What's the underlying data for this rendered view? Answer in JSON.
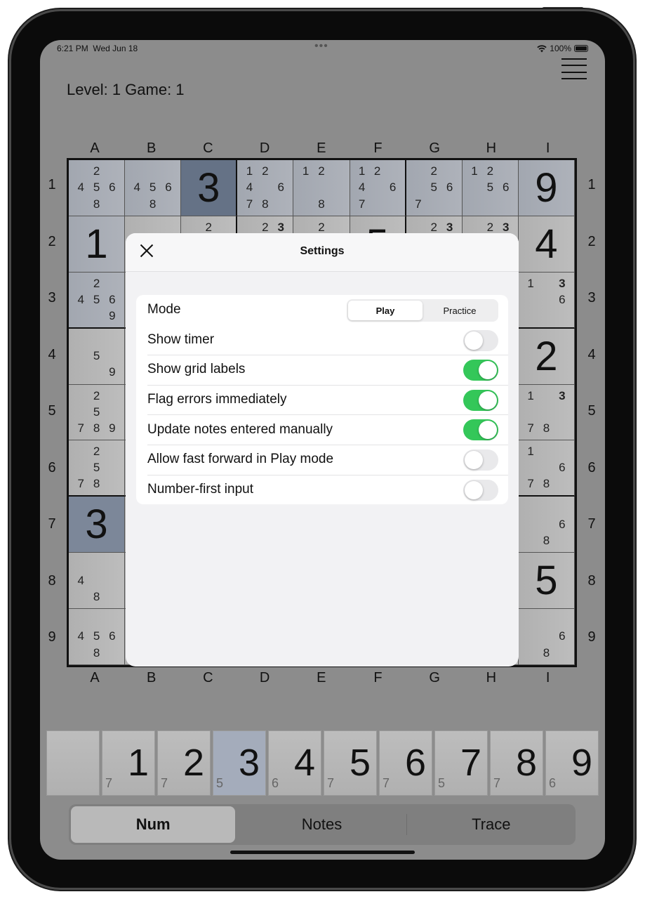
{
  "status": {
    "time": "6:21 PM",
    "date": "Wed Jun 18",
    "dots": "•••",
    "wifi": "◔",
    "battery": "100%"
  },
  "header": {
    "level_game": "Level: 1  Game: 1"
  },
  "columns": [
    "A",
    "B",
    "C",
    "D",
    "E",
    "F",
    "G",
    "H",
    "I"
  ],
  "rows": [
    "1",
    "2",
    "3",
    "4",
    "5",
    "6",
    "7",
    "8",
    "9"
  ],
  "board": [
    [
      {
        "n": "2 456 8",
        "s": "hl"
      },
      {
        "n": "456 8",
        "s": "hl"
      },
      {
        "v": "3",
        "s": "sel"
      },
      {
        "n": "12 4 6 78",
        "s": "hl"
      },
      {
        "n": "12  8",
        "s": "hl"
      },
      {
        "n": "12 4 6 7",
        "s": "hl"
      },
      {
        "n": "2 56 7",
        "s": "hl"
      },
      {
        "n": "12 56",
        "s": "hl"
      },
      {
        "v": "9",
        "s": "hl"
      }
    ],
    [
      {
        "v": "1",
        "s": "hl"
      },
      {
        "n": "",
        "s": ""
      },
      {
        "n": "2",
        "s": ""
      },
      {
        "n": "2B3",
        "s": ""
      },
      {
        "n": "2",
        "s": ""
      },
      {
        "v": "5",
        "s": ""
      },
      {
        "n": "2B3",
        "s": ""
      },
      {
        "n": "2B3",
        "s": ""
      },
      {
        "v": "4",
        "s": ""
      }
    ],
    [
      {
        "n": "2 456 9",
        "s": "hl"
      },
      {
        "n": "",
        "s": ""
      },
      {
        "n": "",
        "s": ""
      },
      {
        "n": "",
        "s": ""
      },
      {
        "n": "",
        "s": ""
      },
      {
        "n": "",
        "s": ""
      },
      {
        "n": "",
        "s": ""
      },
      {
        "n": "",
        "s": ""
      },
      {
        "n": "1B3 6",
        "s": ""
      }
    ],
    [
      {
        "n": "5 9",
        "s": ""
      },
      {
        "n": "",
        "s": ""
      },
      {
        "n": "",
        "s": ""
      },
      {
        "n": "",
        "s": ""
      },
      {
        "n": "",
        "s": ""
      },
      {
        "n": "",
        "s": ""
      },
      {
        "n": "",
        "s": ""
      },
      {
        "n": "",
        "s": ""
      },
      {
        "v": "2",
        "s": ""
      }
    ],
    [
      {
        "n": "2 5 789",
        "s": ""
      },
      {
        "n": "",
        "s": ""
      },
      {
        "n": "",
        "s": ""
      },
      {
        "n": "",
        "s": ""
      },
      {
        "n": "",
        "s": ""
      },
      {
        "n": "",
        "s": ""
      },
      {
        "n": "",
        "s": ""
      },
      {
        "n": "",
        "s": ""
      },
      {
        "n": "1B3 78",
        "s": ""
      }
    ],
    [
      {
        "n": "2 5 78",
        "s": ""
      },
      {
        "n": "",
        "s": ""
      },
      {
        "n": "",
        "s": ""
      },
      {
        "n": "",
        "s": ""
      },
      {
        "n": "",
        "s": ""
      },
      {
        "n": "",
        "s": ""
      },
      {
        "n": "",
        "s": ""
      },
      {
        "n": "",
        "s": ""
      },
      {
        "n": "1 6 78",
        "s": ""
      }
    ],
    [
      {
        "v": "3",
        "s": "sel2"
      },
      {
        "n": "",
        "s": ""
      },
      {
        "n": "",
        "s": ""
      },
      {
        "n": "",
        "s": ""
      },
      {
        "n": "",
        "s": ""
      },
      {
        "n": "",
        "s": ""
      },
      {
        "n": "",
        "s": ""
      },
      {
        "n": "",
        "s": ""
      },
      {
        "n": "6 8",
        "s": ""
      }
    ],
    [
      {
        "n": "4 8",
        "s": ""
      },
      {
        "n": "",
        "s": ""
      },
      {
        "n": "",
        "s": ""
      },
      {
        "n": "",
        "s": ""
      },
      {
        "n": "",
        "s": ""
      },
      {
        "n": "",
        "s": ""
      },
      {
        "n": "",
        "s": ""
      },
      {
        "n": "",
        "s": ""
      },
      {
        "v": "5",
        "s": ""
      }
    ],
    [
      {
        "n": "456 8",
        "s": ""
      },
      {
        "n": "",
        "s": ""
      },
      {
        "n": "",
        "s": ""
      },
      {
        "n": "",
        "s": ""
      },
      {
        "n": "",
        "s": ""
      },
      {
        "n": "",
        "s": ""
      },
      {
        "n": "",
        "s": ""
      },
      {
        "n": "",
        "s": ""
      },
      {
        "n": "6 8",
        "s": ""
      }
    ]
  ],
  "numpad": [
    {
      "num": "",
      "count": ""
    },
    {
      "num": "1",
      "count": "7"
    },
    {
      "num": "2",
      "count": "7"
    },
    {
      "num": "3",
      "count": "5",
      "selected": true
    },
    {
      "num": "4",
      "count": "6"
    },
    {
      "num": "5",
      "count": "7"
    },
    {
      "num": "6",
      "count": "7"
    },
    {
      "num": "7",
      "count": "5"
    },
    {
      "num": "8",
      "count": "7"
    },
    {
      "num": "9",
      "count": "6"
    }
  ],
  "modes": {
    "num": "Num",
    "notes": "Notes",
    "trace": "Trace",
    "active": "num"
  },
  "settings": {
    "title": "Settings",
    "mode_label": "Mode",
    "mode_options": [
      "Play",
      "Practice"
    ],
    "mode_selected": "Play",
    "toggles": [
      {
        "label": "Show timer",
        "on": false
      },
      {
        "label": "Show grid labels",
        "on": true
      },
      {
        "label": "Flag errors immediately",
        "on": true
      },
      {
        "label": "Update notes entered manually",
        "on": true
      },
      {
        "label": "Allow fast forward in Play mode",
        "on": false
      },
      {
        "label": "Number-first input",
        "on": false
      }
    ]
  },
  "colors": {
    "toggle_on": "#34c759",
    "selected_cell": "#657286",
    "highlight_cell": "#a2a7b0"
  },
  "icons": {
    "close": "close-icon",
    "menu": "hamburger-menu-icon",
    "wifi": "wifi-icon",
    "battery": "battery-icon"
  }
}
